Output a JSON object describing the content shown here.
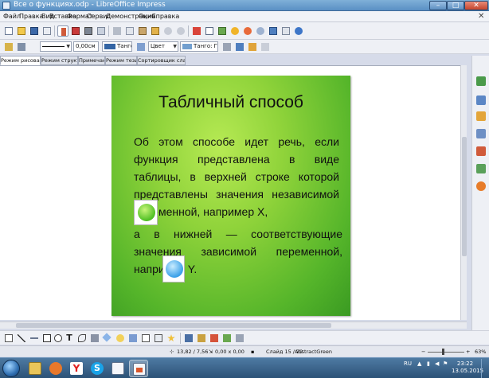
{
  "window": {
    "title": "Все о функциях.odp - LibreOffice Impress",
    "min_glyph": "–",
    "max_glyph": "□",
    "close_glyph": "✕"
  },
  "menu": {
    "items": [
      "Файл",
      "Правка",
      "Вид",
      "Вставка",
      "Формат",
      "Сервис",
      "Демонстрация",
      "Окно",
      "Справка"
    ],
    "close_glyph": "✕"
  },
  "toolbar2": {
    "line_width": "0,00см",
    "line_color": "Тангол",
    "area_style": "Цвет",
    "area_color": "Танго: Гол"
  },
  "tabs": [
    "Режим рисования",
    "Режим структуры",
    "Примечания",
    "Режим тезисов",
    "Сортировщик слайдов"
  ],
  "slide": {
    "title": "Табличный способ",
    "paragraph1": "Об этом способе идет речь, если функция представлена в виде таблицы, в верхней строке которой представлены значения независимой переменной, например Х,",
    "paragraph2": "а в нижней — соответствующие значения зависимой переменной, например Y.",
    "colors": {
      "bg_light": "#b7ea54",
      "bg_dark": "#3a9a22"
    }
  },
  "status": {
    "position": "13,82 / 7,56",
    "size": "0,00 x 0,00",
    "slide": "Слайд 15 / 22",
    "master": "AbstractGreen",
    "zoom": "63%"
  },
  "taskbar": {
    "lang": "RU",
    "time": "23:22",
    "date": "13.05.2015",
    "apps": [
      "explorer",
      "media-player",
      "yandex-browser",
      "skype",
      "document",
      "libreoffice-impress"
    ]
  }
}
